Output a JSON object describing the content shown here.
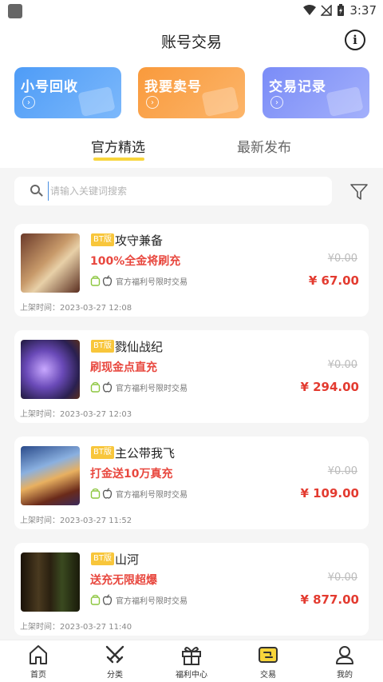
{
  "status_bar": {
    "time": "3:37"
  },
  "header": {
    "title": "账号交易",
    "info_glyph": "i"
  },
  "actions": [
    {
      "label": "小号回收",
      "color": "#4e9cf7",
      "icon": "wallet-icon"
    },
    {
      "label": "我要卖号",
      "color": "#f99a3c",
      "icon": "coin-bag-icon"
    },
    {
      "label": "交易记录",
      "color": "#7a8cf7",
      "icon": "card-icon"
    }
  ],
  "tabs": {
    "featured": "官方精选",
    "latest": "最新发布"
  },
  "search": {
    "placeholder": "请输入关键词搜索"
  },
  "listings": [
    {
      "badge": "BT版",
      "name": "攻守兼备",
      "promo": "100%全金将刷充",
      "official": "官方福利号限时交易",
      "original_price": "¥0.00",
      "price": "¥ 67.00",
      "listed": "上架时间：2023-03-27 12:08"
    },
    {
      "badge": "BT版",
      "name": "戮仙战纪",
      "promo": "刷现金点直充",
      "official": "官方福利号限时交易",
      "original_price": "¥0.00",
      "price": "¥ 294.00",
      "listed": "上架时间：2023-03-27 12:03"
    },
    {
      "badge": "BT版",
      "name": "主公带我飞",
      "promo": "打金送10万真充",
      "official": "官方福利号限时交易",
      "original_price": "¥0.00",
      "price": "¥ 109.00",
      "listed": "上架时间：2023-03-27 11:52"
    },
    {
      "badge": "BT版",
      "name": "山河",
      "promo": "送充无限超爆",
      "official": "官方福利号限时交易",
      "original_price": "¥0.00",
      "price": "¥ 877.00",
      "listed": "上架时间：2023-03-27 11:40"
    }
  ],
  "nav": [
    {
      "label": "首页",
      "icon": "home-icon"
    },
    {
      "label": "分类",
      "icon": "crossed-swords-icon"
    },
    {
      "label": "福利中心",
      "icon": "gift-icon"
    },
    {
      "label": "交易",
      "icon": "trade-icon",
      "active": true
    },
    {
      "label": "我的",
      "icon": "user-icon"
    }
  ],
  "colors": {
    "accent": "#f8d53b",
    "price_red": "#e33b30",
    "promo_red": "#e8473e",
    "badge": "#f8c63b"
  }
}
